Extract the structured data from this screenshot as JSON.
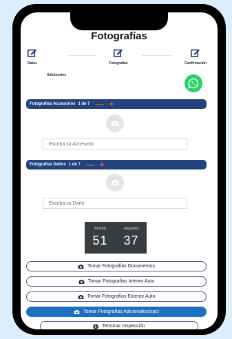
{
  "header": {
    "title": "Fotografías"
  },
  "steps": [
    {
      "label": "Datos",
      "icon": "edit-icon"
    },
    {
      "label": "Fotografias",
      "icon": "edit-icon"
    },
    {
      "label": "Confirmación",
      "icon": "edit-icon"
    }
  ],
  "adicionales_label": "Adicionales",
  "whatsapp_icon": "whatsapp-icon",
  "accesorios": {
    "title": "Fotografias Accesorios",
    "page": "1 de 7",
    "minus": "—",
    "plus": "+",
    "placeholder": "Escriba su Accesorio"
  },
  "danos": {
    "title": "Fotografias Daños",
    "page": "1 de 7",
    "minus": "—",
    "plus": "+",
    "placeholder": "Escriba su Daño"
  },
  "timer": {
    "minutes_label": "minutos",
    "seconds_label": "segundos",
    "minutes": "51",
    "seconds": "37"
  },
  "buttons": {
    "documentos": "Tomar Fotografías Documentos",
    "interior": "Tomar Fotografías Interior Auto",
    "exterior": "Tomar Fotografías Exterior Auto",
    "adicionales": "Tomar Fotografías Adicionales(opc)",
    "terminar": "Terminar Inspección"
  },
  "colors": {
    "band": "#23437e",
    "primary_button": "#1e6fc0",
    "accent_controls": "#ff5a2a",
    "whatsapp": "#25d366"
  }
}
